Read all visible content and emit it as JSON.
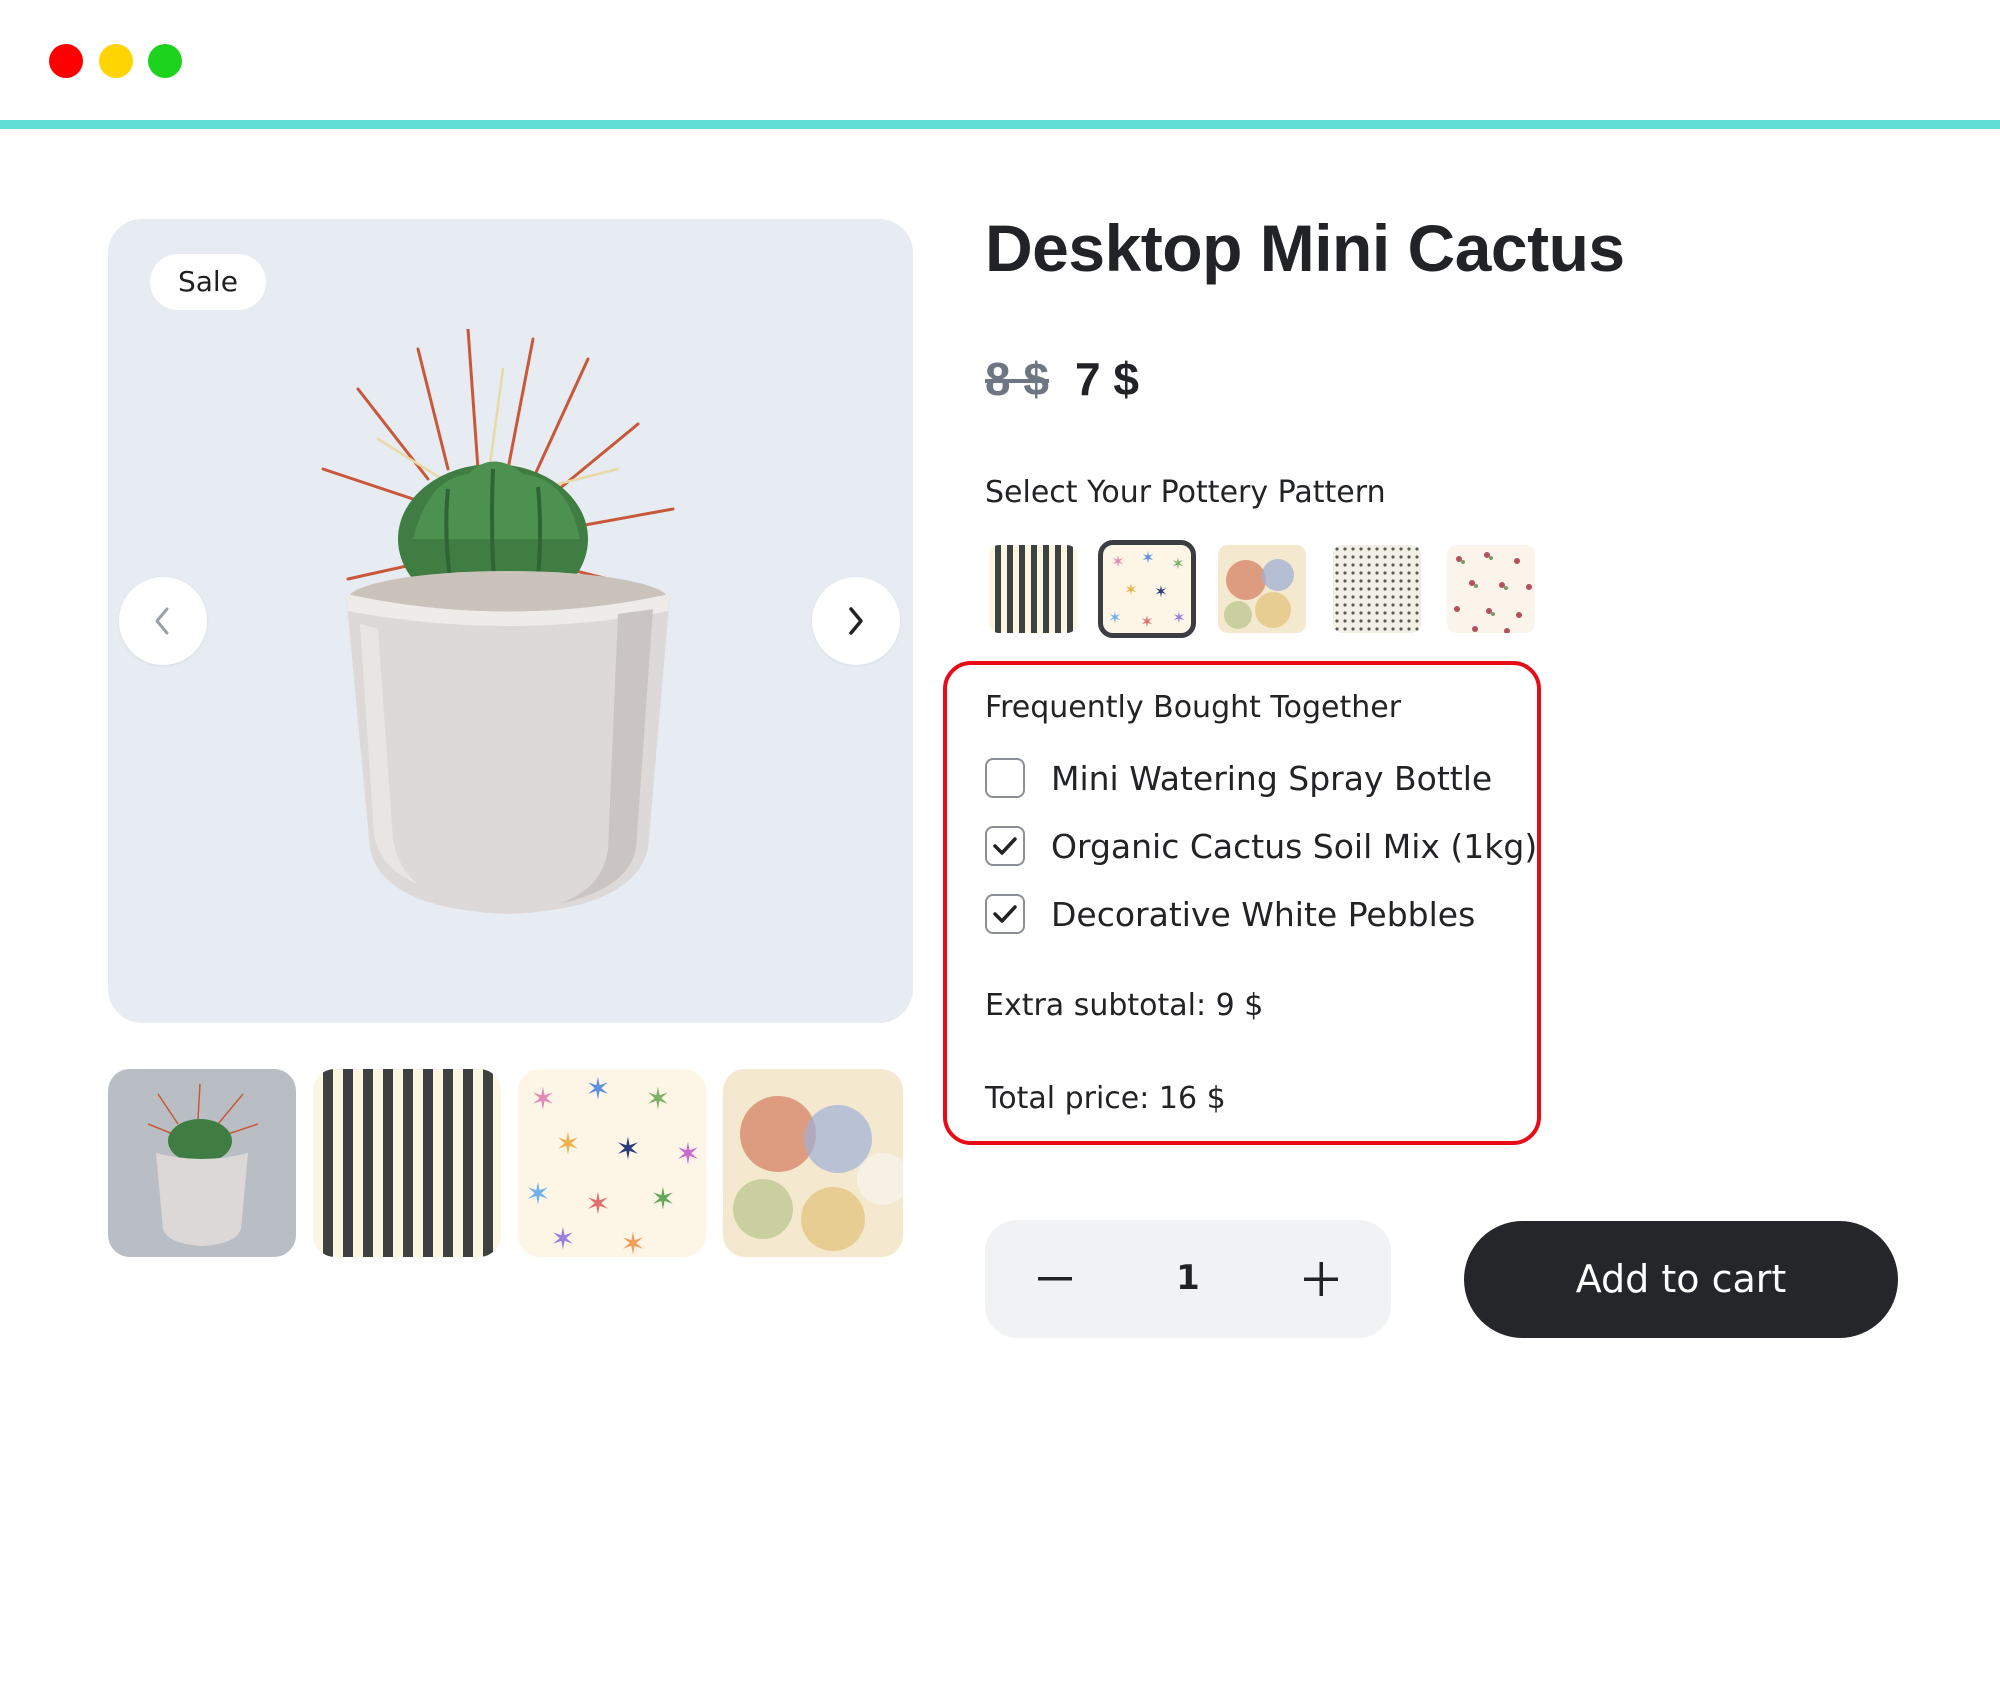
{
  "window": {
    "controls": [
      "close",
      "minimize",
      "maximize"
    ]
  },
  "gallery": {
    "badge": "Sale",
    "prev_icon": "chevron-left-icon",
    "next_icon": "chevron-right-icon",
    "thumbnails": [
      "cactus-photo",
      "stripes-pattern",
      "stars-pattern",
      "watercolor-floral-pattern"
    ]
  },
  "product": {
    "title": "Desktop Mini Cactus",
    "old_price": "8 $",
    "price": "7 $"
  },
  "pattern": {
    "label": "Select Your Pottery Pattern",
    "options": [
      "stripes",
      "stars",
      "watercolor-floral",
      "dots",
      "mini-floral"
    ],
    "selected": "stars"
  },
  "bundle": {
    "title": "Frequently Bought Together",
    "items": [
      {
        "label": "Mini Watering Spray Bottle",
        "checked": false
      },
      {
        "label": "Organic Cactus Soil Mix (1kg)",
        "checked": true
      },
      {
        "label": "Decorative White Pebbles",
        "checked": true
      }
    ],
    "subtotal": "Extra subtotal:  9 $",
    "total": "Total price:  16 $"
  },
  "quantity": {
    "value": "1",
    "minus_icon": "minus-icon",
    "plus_icon": "plus-icon"
  },
  "cart": {
    "button_label": "Add to cart"
  },
  "colors": {
    "accent_line": "#62dfd6",
    "highlight_border": "#e80c18",
    "button_dark": "#242629"
  }
}
